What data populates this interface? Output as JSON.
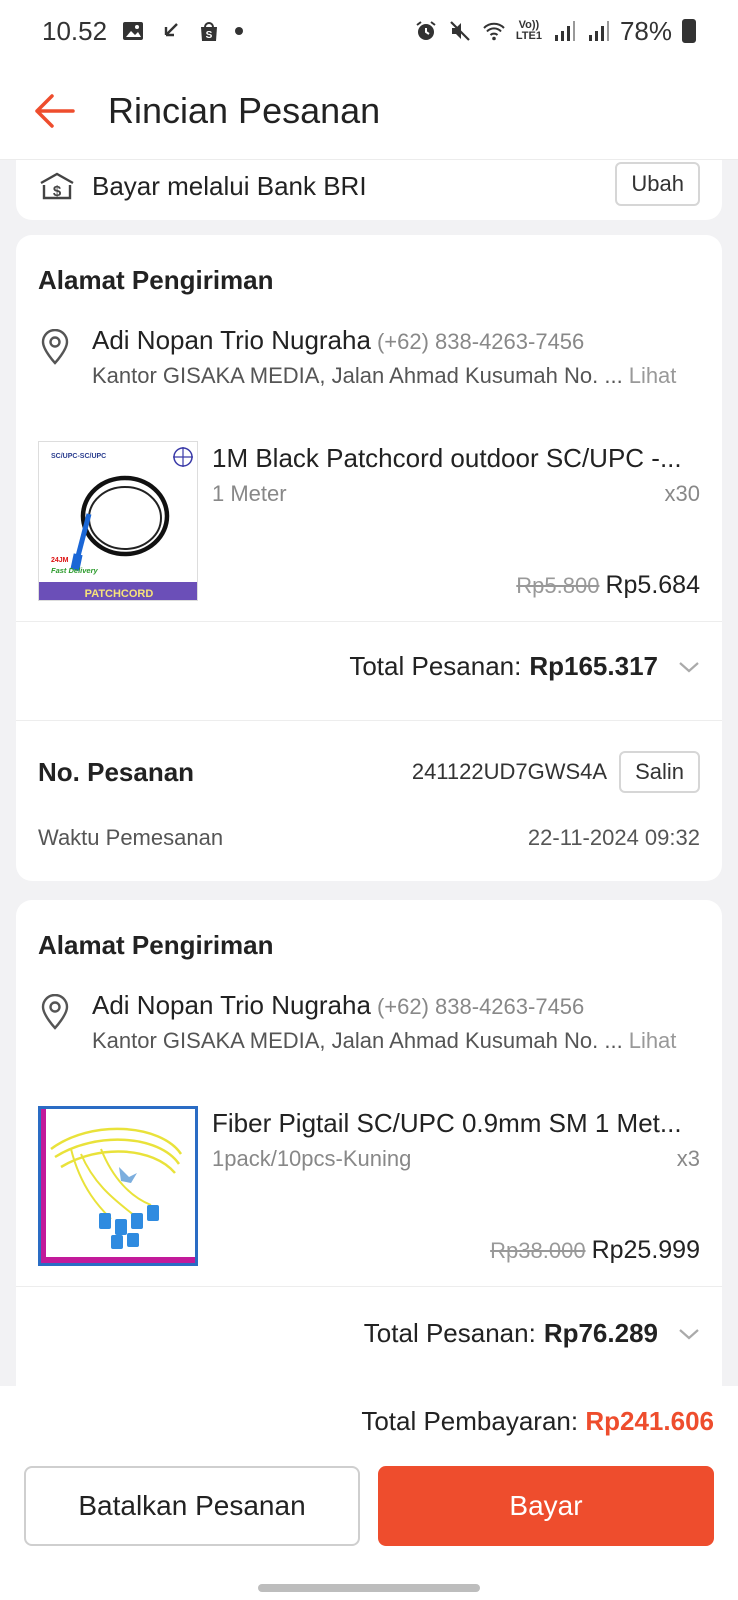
{
  "status_bar": {
    "time": "10.52",
    "battery": "78%",
    "network": "LTE1"
  },
  "header": {
    "title": "Rincian Pesanan"
  },
  "payment": {
    "method": "Bayar melalui Bank BRI",
    "change_label": "Ubah"
  },
  "orders": [
    {
      "section_title": "Alamat Pengiriman",
      "recipient": "Adi Nopan Trio Nugraha",
      "phone": "(+62) 838-4263-7456",
      "address": "Kantor GISAKA MEDIA, Jalan Ahmad Kusumah No. ...",
      "view_label": "Lihat",
      "product": {
        "name": "1M Black Patchcord outdoor SC/UPC -...",
        "variant": "1 Meter",
        "qty": "x30",
        "old_price": "Rp5.800",
        "price": "Rp5.684",
        "thumb_top_text": "SC/UPC-SC/UPC",
        "thumb_tag": "Fast Delivery",
        "thumb_banner": "PATCHCORD"
      },
      "total_label": "Total Pesanan:",
      "total_amount": "Rp165.317",
      "order_no_label": "No. Pesanan",
      "order_no": "241122UD7GWS4A",
      "copy_label": "Salin",
      "time_label": "Waktu Pemesanan",
      "time_value": "22-11-2024 09:32"
    },
    {
      "section_title": "Alamat Pengiriman",
      "recipient": "Adi Nopan Trio Nugraha",
      "phone": "(+62) 838-4263-7456",
      "address": "Kantor GISAKA MEDIA, Jalan Ahmad Kusumah No. ...",
      "view_label": "Lihat",
      "product": {
        "name": "Fiber Pigtail SC/UPC 0.9mm SM 1 Met...",
        "variant": "1pack/10pcs-Kuning",
        "qty": "x3",
        "old_price": "Rp38.000",
        "price": "Rp25.999"
      },
      "total_label": "Total Pesanan:",
      "total_amount": "Rp76.289"
    }
  ],
  "footer": {
    "grand_label": "Total Pembayaran:",
    "grand_amount": "Rp241.606",
    "cancel_label": "Batalkan Pesanan",
    "pay_label": "Bayar"
  },
  "colors": {
    "accent": "#ee4d2d",
    "background": "#f2f2f4"
  }
}
